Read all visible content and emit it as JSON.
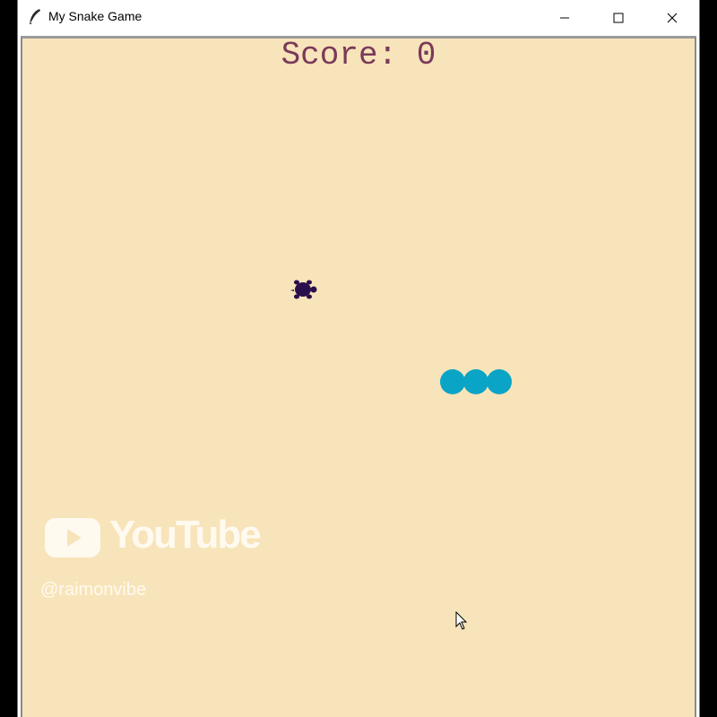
{
  "window": {
    "title": "My Snake Game",
    "controls": {
      "minimize": "minimize-icon",
      "maximize": "maximize-icon",
      "close": "close-icon"
    }
  },
  "game": {
    "score_text": "Score: 0",
    "background_color": "#f8e4ba",
    "food": {
      "icon": "turtle-icon",
      "color": "#2a0f4d"
    },
    "snake": {
      "segments": 3,
      "color": "#0aa4c6"
    }
  },
  "watermark": {
    "brand": "YouTube",
    "handle": "@raimonvibe"
  }
}
